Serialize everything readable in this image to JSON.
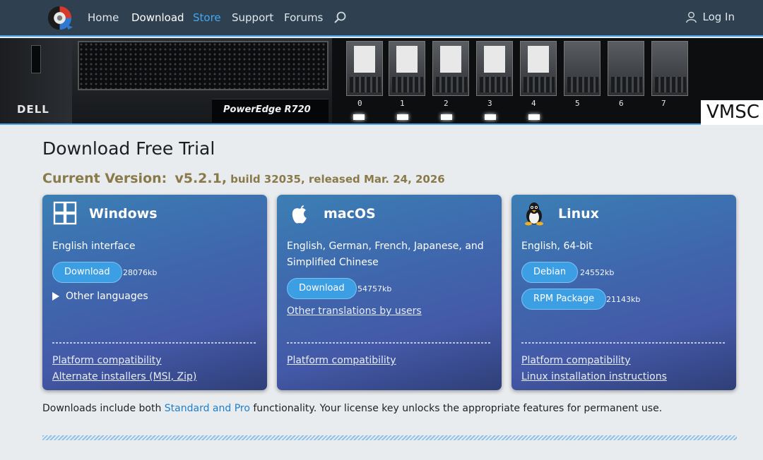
{
  "nav": {
    "items": [
      {
        "label": "Home"
      },
      {
        "label": "Download"
      },
      {
        "label": "Store"
      },
      {
        "label": "Support"
      },
      {
        "label": "Forums"
      }
    ],
    "login_label": "Log In"
  },
  "hero": {
    "brand_badge": "DELL",
    "model": "PowerEdge R720",
    "overlay_text": "VMSC",
    "bays": [
      "0",
      "1",
      "2",
      "3",
      "4",
      "5",
      "6",
      "7"
    ]
  },
  "page": {
    "title": "Download Free Trial",
    "version_label": "Current Version:",
    "version_number": "v5.2.1,",
    "version_details": "build 32035, released Mar. 24, 2026"
  },
  "cards": [
    {
      "title": "Windows",
      "icon": "windows-icon",
      "description": "English interface",
      "buttons": [
        {
          "label": "Download",
          "size": "28076kb"
        }
      ],
      "expander": "Other languages",
      "links": [
        "Platform compatibility",
        "Alternate installers (MSI, Zip)"
      ]
    },
    {
      "title": "macOS",
      "icon": "apple-icon",
      "description": "English, German, French, Japanese, and Simplified Chinese",
      "buttons": [
        {
          "label": "Download",
          "size": "54757kb"
        }
      ],
      "extra_link": "Other translations by users",
      "links": [
        "Platform compatibility"
      ]
    },
    {
      "title": "Linux",
      "icon": "penguin-icon",
      "description": "English, 64-bit",
      "buttons": [
        {
          "label": "Debian",
          "size": "24552kb"
        },
        {
          "label": "RPM Package",
          "size": "21143kb"
        }
      ],
      "links": [
        "Platform compatibility",
        "Linux installation instructions"
      ]
    }
  ],
  "footer": {
    "pre": "Downloads include both ",
    "link": "Standard and Pro",
    "post": " functionality.  Your license key unlocks the appropriate features for permanent use."
  },
  "colors": {
    "nav_bg": "#2f4150",
    "accent": "#43a8f0",
    "version_text": "#8a7a4a",
    "button_bg": "#3c9ee3"
  }
}
